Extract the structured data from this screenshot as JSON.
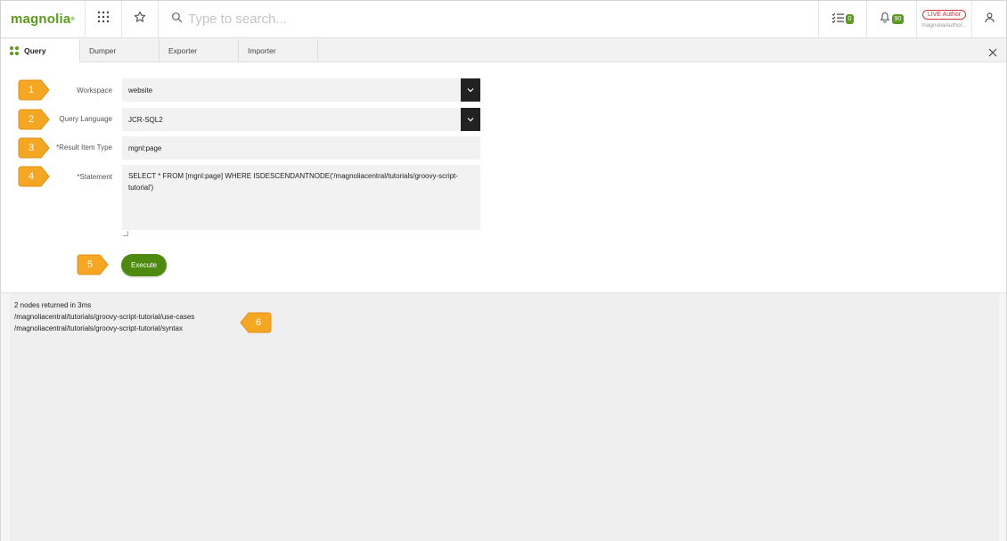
{
  "header": {
    "logo": "magnolia",
    "logo_mark": "®",
    "search_placeholder": "Type to search...",
    "tasks_count": "0",
    "notifications_count": "90",
    "env_badge": "LIVE Author",
    "user_name": "magnoliaAuthor..."
  },
  "tabs": [
    {
      "label": "Query",
      "active": true
    },
    {
      "label": "Dumper"
    },
    {
      "label": "Exporter"
    },
    {
      "label": "Importer"
    }
  ],
  "form": {
    "workspace_label": "Workspace",
    "workspace_value": "website",
    "language_label": "Query Language",
    "language_value": "JCR-SQL2",
    "result_type_label": "*Result Item Type",
    "result_type_value": "mgnl:page",
    "statement_label": "*Statement",
    "statement_value": "SELECT * FROM [mgnl:page] WHERE ISDESCENDANTNODE('/magnoliacentral/tutorials/groovy-script-tutorial')",
    "execute_label": "Execute"
  },
  "result": {
    "summary": "2 nodes returned in 3ms",
    "lines": [
      "/magnoliacentral/tutorials/groovy-script-tutorial/use-cases",
      "/magnoliacentral/tutorials/groovy-script-tutorial/syntax"
    ]
  },
  "callouts": [
    "1",
    "2",
    "3",
    "4",
    "5",
    "6"
  ],
  "colors": {
    "brand_green": "#599b1c",
    "button_green": "#4f8a10",
    "callout_orange": "#f5a623",
    "live_red": "#d0343a"
  },
  "icons": [
    "app-launcher-icon",
    "star-icon",
    "search-icon",
    "tasks-icon",
    "bell-icon",
    "user-icon",
    "query-app-icon",
    "close-icon",
    "chevron-down-icon"
  ]
}
